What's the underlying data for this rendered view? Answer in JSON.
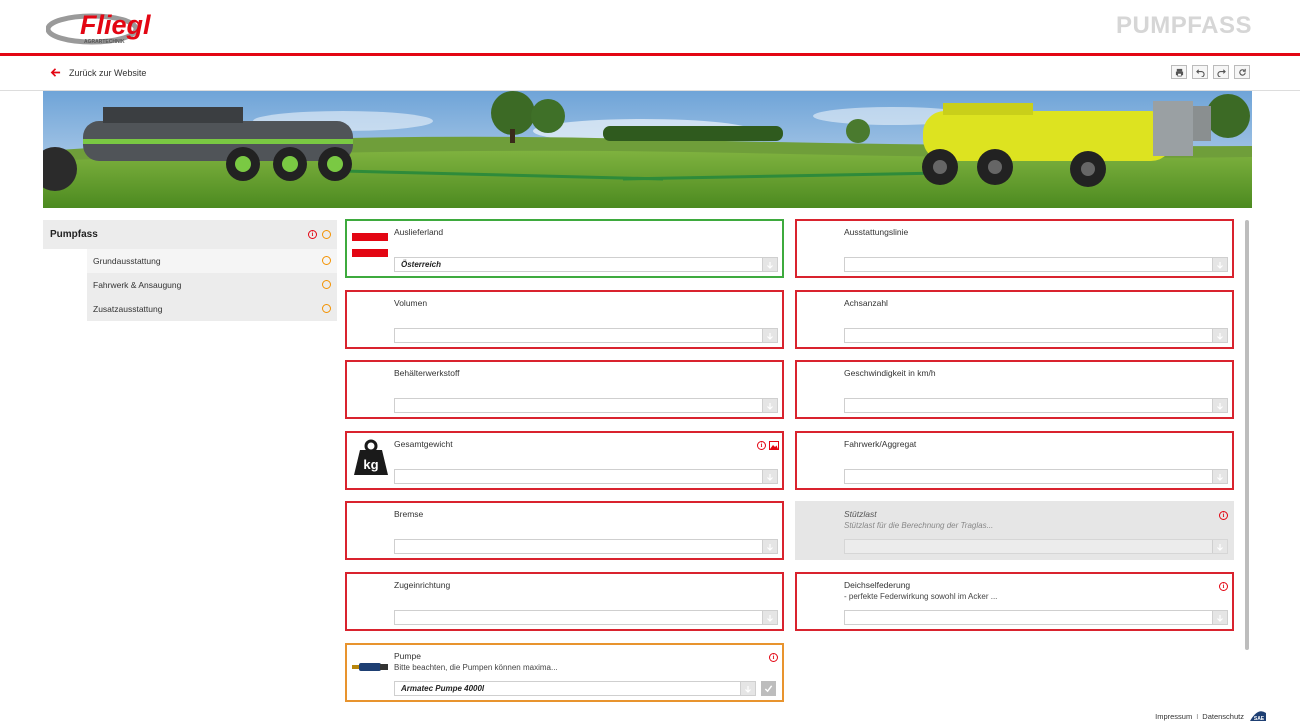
{
  "header": {
    "logo_text": "Fliegl",
    "logo_subtext": "AGRARTECHNIK",
    "page_title": "PUMPFASS"
  },
  "nav": {
    "back_label": "Zurück zur Website",
    "tools": [
      "print-icon",
      "undo-icon",
      "redo-icon",
      "reload-icon"
    ]
  },
  "banner": {
    "description_icon": "landscape-image"
  },
  "sidebar": {
    "main": "Pumpfass",
    "items": [
      "Grundausstattung",
      "Fahrwerk & Ansaugung",
      "Zusatzausstattung"
    ]
  },
  "left_cards": [
    {
      "label": "Auslieferland",
      "value": "Österreich",
      "state": "green",
      "icon": "austria-flag-icon"
    },
    {
      "label": "Volumen",
      "value": "",
      "state": "red"
    },
    {
      "label": "Behälterwerkstoff",
      "value": "",
      "state": "red"
    },
    {
      "label": "Gesamtgewicht",
      "value": "",
      "state": "red",
      "icon": "weight-kg-icon",
      "weight_text": "kg"
    },
    {
      "label": "Bremse",
      "value": "",
      "state": "red"
    },
    {
      "label": "Zugeinrichtung",
      "value": "",
      "state": "red"
    },
    {
      "label": "Pumpe",
      "desc": "Bitte beachten, die Pumpen können maxima...",
      "value": "Armatec Pumpe 4000l",
      "state": "orange",
      "icon": "pump-icon"
    }
  ],
  "right_cards": [
    {
      "label": "Ausstattungslinie",
      "value": "",
      "state": "red"
    },
    {
      "label": "Achsanzahl",
      "value": "",
      "state": "red"
    },
    {
      "label": "Geschwindigkeit in km/h",
      "value": "",
      "state": "red"
    },
    {
      "label": "Fahrwerk/Aggregat",
      "value": "",
      "state": "red"
    },
    {
      "label": "Stützlast",
      "desc": "Stützlast für die Berechnung der Traglas...",
      "value": "",
      "state": "disabled"
    },
    {
      "label": "Deichselfederung",
      "desc": "- perfekte Federwirkung sowohl im Acker ...",
      "value": "",
      "state": "red"
    }
  ],
  "footer": {
    "impressum": "Impressum",
    "separator": "I",
    "datenschutz": "Datenschutz",
    "badge": "SAE"
  },
  "colors": {
    "brand_red": "#e30613",
    "ok_green": "#3eaa3e",
    "warn_orange": "#f39200"
  }
}
